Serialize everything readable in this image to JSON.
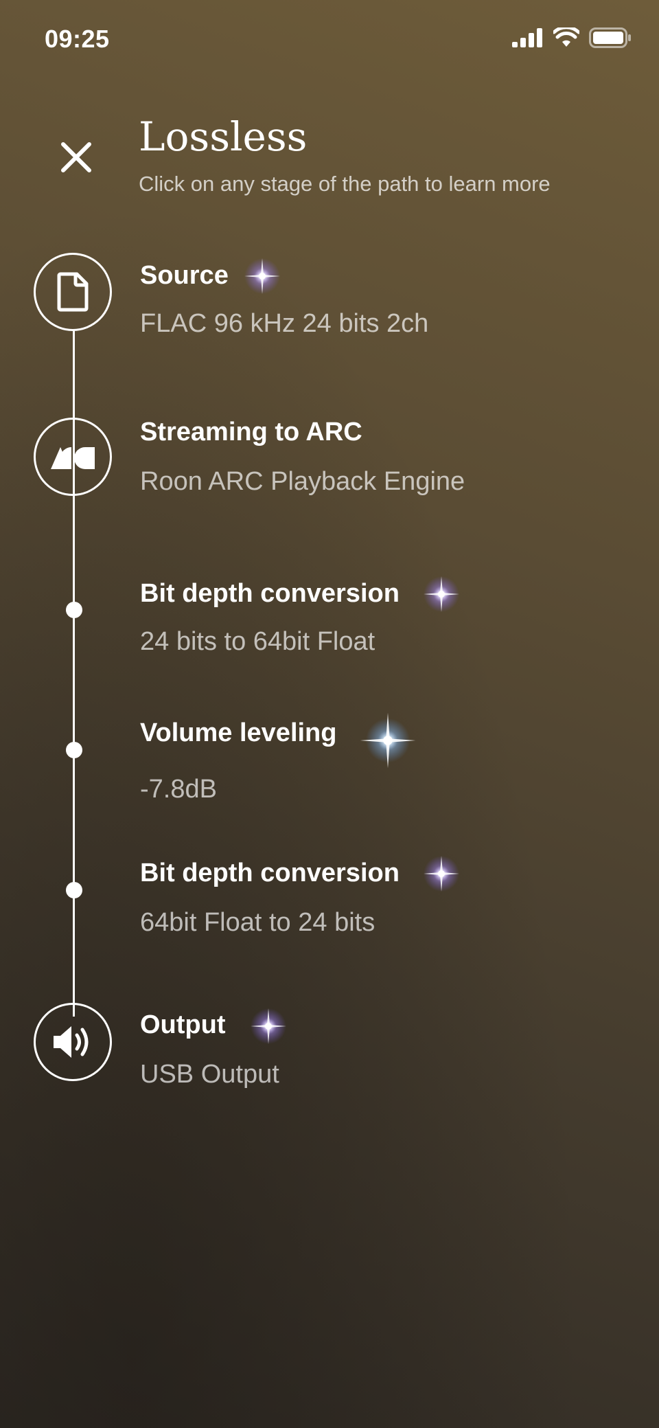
{
  "status_bar": {
    "time": "09:25",
    "icons": [
      "cellular-signal-icon",
      "wifi-icon",
      "battery-icon"
    ]
  },
  "header": {
    "close_icon": "close-icon",
    "title": "Lossless",
    "subtitle": "Click on any stage of the path to learn more"
  },
  "colors": {
    "background_top": "#6e5c3a",
    "background_bottom": "#2f2a24",
    "text_primary": "#ffffff",
    "text_secondary": "#c9c3b8",
    "sparkle_purple": "#b9a6ff",
    "sparkle_blue": "#a9d2ff"
  },
  "signal_path": {
    "stages": [
      {
        "title": "Source",
        "detail": "FLAC 96 kHz 24 bits 2ch",
        "node": "file-icon",
        "sparkle": "purple-sparkle-icon"
      },
      {
        "title": "Streaming to ARC",
        "detail": "Roon ARC Playback Engine",
        "node": "arc-logo-icon",
        "sparkle": ""
      },
      {
        "title": "Bit depth conversion",
        "detail": "24 bits to 64bit Float",
        "node": "dot",
        "sparkle": "purple-sparkle-icon"
      },
      {
        "title": "Volume leveling",
        "detail": "-7.8dB",
        "node": "dot",
        "sparkle": "blue-sparkle-icon"
      },
      {
        "title": "Bit depth conversion",
        "detail": "64bit Float to 24 bits",
        "node": "dot",
        "sparkle": "purple-sparkle-icon"
      },
      {
        "title": "Output",
        "detail": "USB Output",
        "node": "speaker-icon",
        "sparkle": "purple-sparkle-icon"
      }
    ]
  }
}
